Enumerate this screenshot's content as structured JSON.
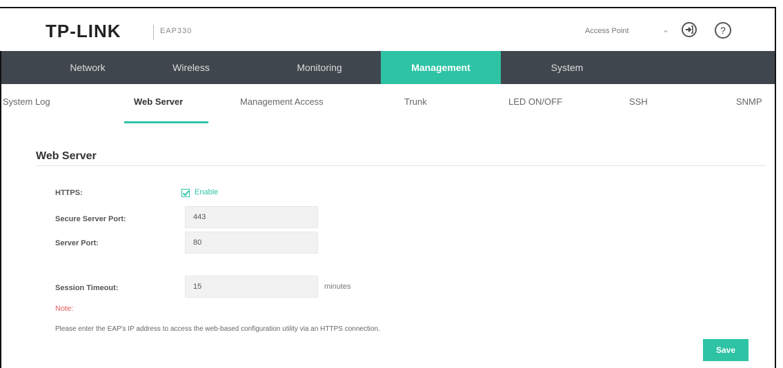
{
  "header": {
    "logo": "TP-LINK",
    "model": "EAP330",
    "mode": "Access Point",
    "mode_arrow": "⌄",
    "logout_icon": "logout-icon",
    "help_icon": "help-icon",
    "help_symbol": "?"
  },
  "main_nav": {
    "items": [
      {
        "label": "Network"
      },
      {
        "label": "Wireless"
      },
      {
        "label": "Monitoring"
      },
      {
        "label": "Management",
        "active": true
      },
      {
        "label": "System"
      }
    ]
  },
  "sub_nav": {
    "items": [
      {
        "label": "System Log"
      },
      {
        "label": "Web Server",
        "active": true
      },
      {
        "label": "Management Access"
      },
      {
        "label": "Trunk"
      },
      {
        "label": "LED ON/OFF"
      },
      {
        "label": "SSH"
      },
      {
        "label": "SNMP"
      }
    ]
  },
  "web_server": {
    "title": "Web Server",
    "https_label": "HTTPS:",
    "https_enable_label": "Enable",
    "https_enabled": true,
    "secure_port_label": "Secure Server Port:",
    "secure_port_value": "443",
    "server_port_label": "Server Port:",
    "server_port_value": "80",
    "session_timeout_label": "Session Timeout:",
    "session_timeout_value": "15",
    "session_timeout_unit": "minutes",
    "note_label": "Note:",
    "note_text": "Please enter the EAP's IP address to access the web-based configuration utility via an HTTPS connection.",
    "save_label": "Save"
  },
  "colors": {
    "accent": "#2ec3a5",
    "nav_bg": "#40464d",
    "note": "#e06060"
  }
}
